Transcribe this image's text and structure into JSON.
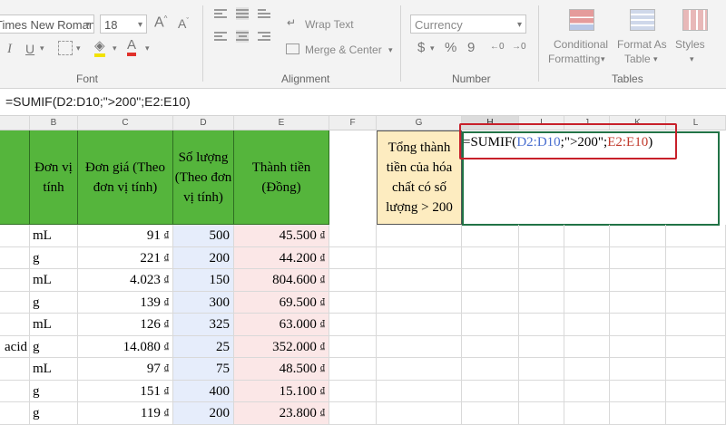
{
  "ribbon": {
    "font_name": "Times New Roman",
    "font_size": "18",
    "font_group_label": "Font",
    "alignment_group_label": "Alignment",
    "wrap_text_label": "Wrap Text",
    "merge_center_label": "Merge & Center",
    "number_format": "Currency",
    "number_group_label": "Number",
    "number_buttons": [
      "$",
      "%",
      "9"
    ],
    "conditional_formatting_label": [
      "Conditional",
      "Formatting"
    ],
    "format_as_table_label": [
      "Format As",
      "Table"
    ],
    "cell_styles_label": "Styles",
    "tables_group_label": "Tables"
  },
  "formula_bar": {
    "text": "=SUMIF(D2:D10;\">200\";E2:E10)"
  },
  "columns": [
    "B",
    "C",
    "D",
    "E",
    "F",
    "G",
    "H",
    "I",
    "J",
    "K",
    "L"
  ],
  "header_row": {
    "b": "Đơn vị tính",
    "c": "Đơn giá (Theo đơn vị tính)",
    "d": "Số lượng (Theo đơn vị tính)",
    "e": "Thành tiền (Đồng)"
  },
  "summary_label": "Tổng thành tiền của hóa chất có số lượng > 200",
  "formula_in_cell": {
    "prefix": "=SUMIF(",
    "range1": "D2:D10",
    "criteria": ";\">200\";",
    "range2": "E2:E10",
    "suffix": ")"
  },
  "currency_symbol": "₫",
  "rows": [
    {
      "a": "",
      "unit": "mL",
      "price": "91",
      "qty": "500",
      "total": "45.500"
    },
    {
      "a": "",
      "unit": "g",
      "price": "221",
      "qty": "200",
      "total": "44.200"
    },
    {
      "a": "",
      "unit": "mL",
      "price": "4.023",
      "qty": "150",
      "total": "804.600"
    },
    {
      "a": "",
      "unit": "g",
      "price": "139",
      "qty": "300",
      "total": "69.500"
    },
    {
      "a": "",
      "unit": "mL",
      "price": "126",
      "qty": "325",
      "total": "63.000"
    },
    {
      "a": "acid",
      "unit": "g",
      "price": "14.080",
      "qty": "25",
      "total": "352.000"
    },
    {
      "a": "",
      "unit": "mL",
      "price": "97",
      "qty": "75",
      "total": "48.500"
    },
    {
      "a": "",
      "unit": "g",
      "price": "151",
      "qty": "400",
      "total": "15.100"
    },
    {
      "a": "",
      "unit": "g",
      "price": "119",
      "qty": "200",
      "total": "23.800"
    }
  ],
  "colors": {
    "header_green": "#55b53c",
    "range_blue": "#4a6fd0",
    "range_red": "#c0392b",
    "callout_red": "#c8202a"
  }
}
